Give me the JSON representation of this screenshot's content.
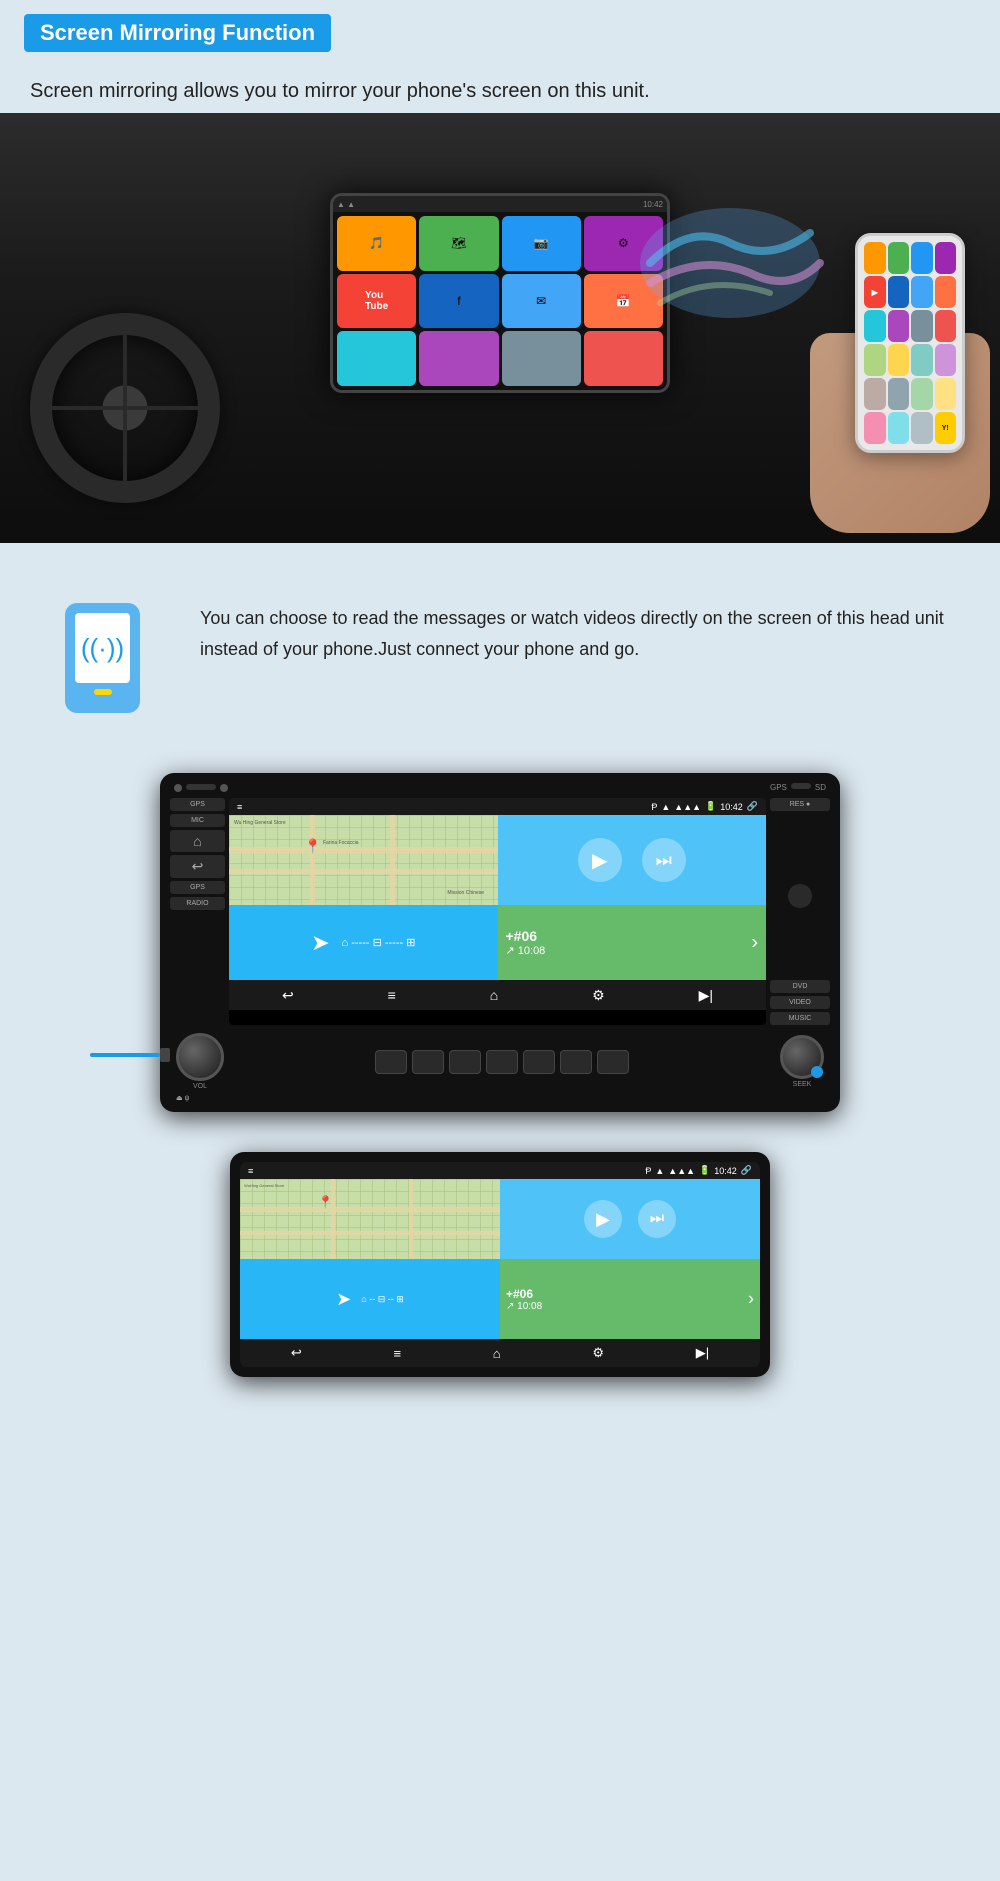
{
  "header": {
    "badge_text": "Screen Mirroring Function",
    "badge_bg": "#1a9be8"
  },
  "description": {
    "text": "Screen mirroring allows you to mirror your phone's screen on this unit."
  },
  "feature": {
    "text": "You can choose to read the messages or watch videos directly on the screen of this head unit instead of your phone.Just connect your phone and go."
  },
  "unit1": {
    "status_bar": {
      "left": "≡",
      "bluetooth": "B",
      "wifi": "▲",
      "signal": "▲▲▲",
      "battery": "🔋",
      "time": "10:42",
      "link": "🔗"
    },
    "left_labels": [
      "GPS",
      "MIC",
      "🏠",
      "↩",
      "GPS",
      "RADIO"
    ],
    "right_labels": [
      "RES",
      "DVD",
      "VIDEO",
      "MUSIC"
    ],
    "bottom_labels": [
      "VOL",
      "SEEK"
    ],
    "call_number": "+#06",
    "call_time": "↗ 10:08",
    "nav_icons": [
      "↩",
      "≡",
      "⌂",
      "⚙",
      "▶|"
    ]
  },
  "unit2": {
    "status_bar": {
      "left": "≡",
      "time": "10:42",
      "link": "🔗"
    },
    "call_number": "+#06",
    "call_time": "↗ 10:08",
    "nav_icons": [
      "↩",
      "≡",
      "⌂",
      "⚙",
      "▶|"
    ]
  },
  "colors": {
    "badge_bg": "#1a9be8",
    "map_bg": "#c8dea8",
    "play_bg": "#4fc3f7",
    "nav_bg": "#29b6f6",
    "call_bg": "#66bb6a",
    "navbar_bg": "#1a1a1a"
  }
}
